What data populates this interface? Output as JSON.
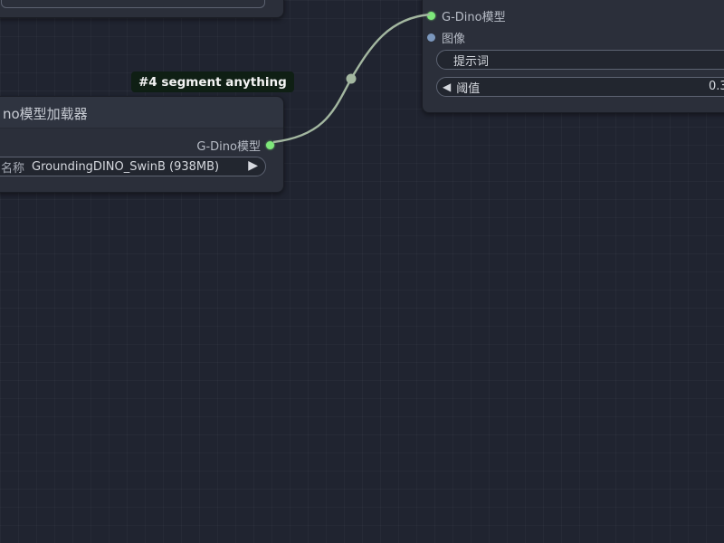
{
  "colors": {
    "canvas_bg": "#202430",
    "node_bg": "#2b2f3a",
    "link_color": "#a3b7a0",
    "gdino_slot": "#7ee87a",
    "image_slot": "#7b97bd",
    "badge_bg": "#0f1f14"
  },
  "loader_node": {
    "title": "no模型加载器",
    "output_label": "G-Dino模型",
    "model_widget": {
      "label": "名称",
      "value": "GroundingDINO_SwinB (938MB)",
      "arrow_icon": "triangle-right-icon"
    }
  },
  "group_badge": {
    "label": "#4 segment anything"
  },
  "segment_node": {
    "inputs": [
      {
        "label": "G-Dino模型",
        "type": "gdino"
      },
      {
        "label": "图像",
        "type": "image"
      }
    ],
    "prompt_widget": {
      "label": "提示词"
    },
    "threshold_widget": {
      "label": "阈值",
      "value": "0.3"
    }
  }
}
